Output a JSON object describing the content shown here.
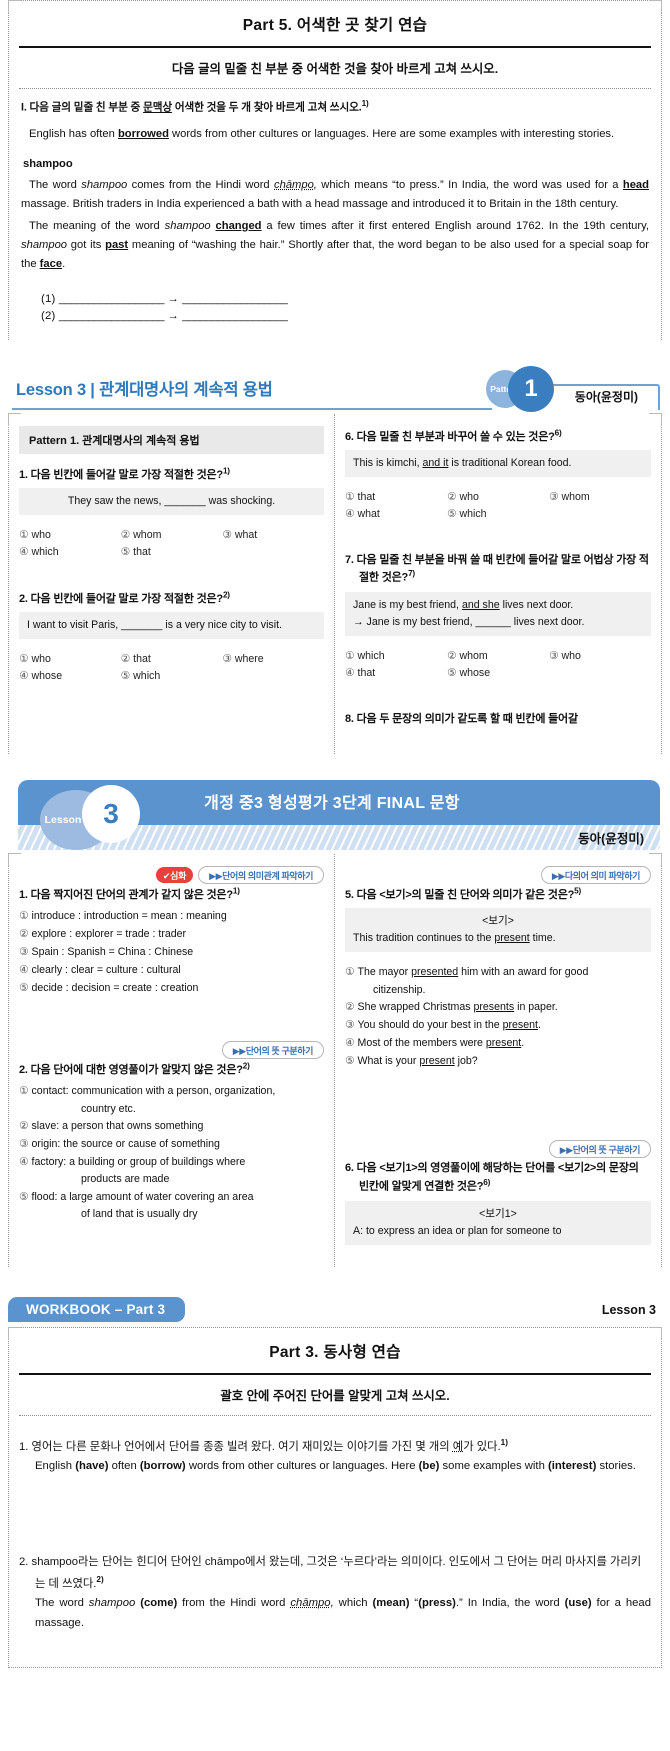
{
  "part5": {
    "title": "Part 5. 어색한 곳 찾기 연습",
    "directive": "다음 글의 밑줄 친 부분 중 어색한 것을 찾아 바르게 고쳐 쓰시오.",
    "question_pre": "I. 다음 글의 밑줄 친 부분 중 ",
    "question_u": "문맥상",
    "question_post": " 어색한 것을 두 개 찾아 바르게 고쳐 쓰시오.",
    "question_sup": "1)",
    "intro_p1_a": "English has often ",
    "intro_p1_b": "borrowed",
    "intro_p1_c": " words from other cultures or languages. Here are some examples with interesting stories.",
    "subhead": "shampoo",
    "p2_a": "The word ",
    "p2_it1": "shampoo",
    "p2_b": " comes from the Hindi word ",
    "p2_it2": "chāmpo,",
    "p2_c": " which means “to press.” In India, the word was used for a ",
    "p2_bu1": "head",
    "p2_d": " massage. British traders in India experienced a bath with a head massage and introduced it to Britain in the 18th century.",
    "p3_a": "The meaning of the word ",
    "p3_it1": "shampoo",
    "p3_b": " ",
    "p3_bu1": "changed",
    "p3_c": " a few times after it first entered English around 1762. In the 19th century, ",
    "p3_it2": "shampoo",
    "p3_d": " got its ",
    "p3_bu2": "past",
    "p3_e": " meaning of “washing the hair.” Shortly after that, the word began to be also used for a special soap for the ",
    "p3_bu3": "face",
    "p3_f": ".",
    "answer_rows": [
      {
        "label": "(1)",
        "blank1": "__________________",
        "arrow": "→",
        "blank2": "__________________"
      },
      {
        "label": "(2)",
        "blank1": "__________________",
        "arrow": "→",
        "blank2": "__________________"
      }
    ]
  },
  "lesson3_pattern": {
    "header_title": "Lesson 3 | 관계대명사의 계속적 용법",
    "pattern_word": "Pattern",
    "pattern_num": "1",
    "author": "동아(윤정미)",
    "pattern_bar": "Pattern 1. 관계대명사의 계속적 용법",
    "left_questions": [
      {
        "num": "1. 다음 빈칸에 들어갈 말로 가장 적절한 것은?",
        "sup": "1)",
        "stem_pre": "They saw the news, ",
        "stem_blank": "_______",
        "stem_post": " was shocking.",
        "stem_center": true,
        "choices": [
          "who",
          "whom",
          "what",
          "which",
          "that"
        ]
      },
      {
        "num": "2. 다음 빈칸에 들어갈 말로 가장 적절한 것은?",
        "sup": "2)",
        "stem_pre": "I want to visit Paris, ",
        "stem_blank": "_______",
        "stem_post": " is a very nice city to visit.",
        "stem_center": false,
        "choices": [
          "who",
          "that",
          "where",
          "whose",
          "which"
        ]
      }
    ],
    "right_questions": [
      {
        "num": "6. 다음 밑줄 친 부분과 바꾸어 쓸 수 있는 것은?",
        "sup": "6)",
        "stem_pre": "This is kimchi, ",
        "stem_u": "and it",
        "stem_post": " is traditional Korean food.",
        "choices": [
          "that",
          "who",
          "whom",
          "what",
          "which"
        ]
      },
      {
        "num": "7. 다음 밑줄 친 부분을 바꿔 쓸 때 빈칸에 들어갈 말로 어법상 가장 적절한 것은?",
        "sup": "7)",
        "stem_line1_pre": "Jane is my best friend, ",
        "stem_line1_u": "and she",
        "stem_line1_post": " lives next door.",
        "stem_line2_pre": "→ Jane is my best friend, ",
        "stem_line2_blank": "______",
        "stem_line2_post": " lives next door.",
        "choices": [
          "which",
          "whom",
          "who",
          "that",
          "whose"
        ]
      }
    ],
    "right_q8": "8. 다음 두 문장의 의미가 같도록 할 때 빈칸에 들어갈"
  },
  "final": {
    "lesson_word": "Lesson",
    "lesson_num": "3",
    "title": "개정 중3 형성평가 3단계 FINAL 문항",
    "author": "동아(윤정미)",
    "left": [
      {
        "badge_red": "✔심화",
        "badge_tag": "▶▶단어의 의미관계 파악하기",
        "num": "1. 다음 짝지어진 단어의 관계가 같지 않은 것은?",
        "sup": "1)",
        "items": [
          "introduce : introduction = mean : meaning",
          "explore : explorer = trade : trader",
          "Spain : Spanish = China : Chinese",
          "clearly : clear = culture : cultural",
          "decide : decision = create : creation"
        ]
      },
      {
        "badge_red": "",
        "badge_tag": "▶▶단어의 뜻 구분하기",
        "num": "2. 다음 단어에 대한 영영풀이가 알맞지 않은 것은?",
        "sup": "2)",
        "items_wrapped": [
          {
            "main": "contact: communication with a person, organization,",
            "cont": "country etc."
          },
          {
            "main": "slave: a person that owns something",
            "cont": ""
          },
          {
            "main": "origin: the source or cause of something",
            "cont": ""
          },
          {
            "main": "factory: a building or group of buildings where",
            "cont": "products are made"
          },
          {
            "main": "flood: a large amount of water covering an area",
            "cont": "of land that is usually dry"
          }
        ]
      }
    ],
    "right": [
      {
        "badge_tag": "▶▶다의어 의미 파악하기",
        "num": "5. 다음 <보기>의 밑줄 친 단어와 의미가 같은 것은?",
        "sup": "5)",
        "box_label": "<보기>",
        "box_pre": "This tradition continues to the ",
        "box_u": "present",
        "box_post": " time.",
        "items_wrapped": [
          {
            "pre": "The mayor ",
            "u": "presented",
            "post": " him with an award for good",
            "cont": "citizenship."
          },
          {
            "pre": "She wrapped Christmas ",
            "u": "presents",
            "post": " in paper.",
            "cont": ""
          },
          {
            "pre": "You should do your best in the ",
            "u": "present",
            "post": ".",
            "cont": ""
          },
          {
            "pre": "Most of the members were ",
            "u": "present",
            "post": ".",
            "cont": ""
          },
          {
            "pre": "What is your ",
            "u": "present",
            "post": " job?",
            "cont": ""
          }
        ]
      },
      {
        "badge_tag": "▶▶단어의 뜻 구분하기",
        "num": "6. 다음 <보기1>의 영영풀이에 해당하는 단어를 <보기2>의 문장의 빈칸에 알맞게 연결한 것은?",
        "sup": "6)",
        "box_label": "<보기1>",
        "box_text": "A: to express an idea or plan for someone to"
      }
    ]
  },
  "workbook": {
    "tab": "WORKBOOK – Part 3",
    "lesson": "Lesson 3",
    "title": "Part 3. 동사형 연습",
    "directive": "괄호 안에 주어진 단어를 알맞게 고쳐 쓰시오.",
    "items": [
      {
        "ko_a": "1. 영어는 다른 문화나 언어에서 단어를 종종 빌려 왔다. 여기 재미있는 이야기를 가진 몇 개의 ",
        "ko_u": "예",
        "ko_b": "가 있다.",
        "sup": "1)",
        "en_parts": [
          {
            "t": "English ",
            "b": false
          },
          {
            "t": "(have)",
            "b": true
          },
          {
            "t": " often ",
            "b": false
          },
          {
            "t": "(borrow)",
            "b": true
          },
          {
            "t": " words from other cultures or languages. Here ",
            "b": false
          },
          {
            "t": "(be)",
            "b": true
          },
          {
            "t": " some examples with ",
            "b": false
          },
          {
            "t": "(interest)",
            "b": true
          },
          {
            "t": " stories.",
            "b": false
          }
        ]
      },
      {
        "ko_a": "2. shampoo라는 단어는 힌디어 단어인 chāmpo에서 왔는데, 그것은 ‘누르다’라는 의미이다. 인도에서 그 단어는 머리 마사지를 가리키는 데 쓰였다.",
        "ko_u": "",
        "ko_b": "",
        "sup": "2)",
        "en_parts": [
          {
            "t": "The word ",
            "b": false
          },
          {
            "t": "shampoo ",
            "b": false,
            "i": true
          },
          {
            "t": "(come)",
            "b": true
          },
          {
            "t": " from the Hindi word ",
            "b": false
          },
          {
            "t": "chāmpo,",
            "b": false,
            "i": true
          },
          {
            "t": " which ",
            "b": false
          },
          {
            "t": "(mean)",
            "b": true
          },
          {
            "t": " “",
            "b": false
          },
          {
            "t": "(press)",
            "b": true
          },
          {
            "t": ".” In India, the word ",
            "b": false
          },
          {
            "t": "(use)",
            "b": true
          },
          {
            "t": " for a head massage.",
            "b": false
          }
        ]
      }
    ]
  },
  "colors": {
    "accent_blue": "#5b93ce",
    "deep_blue": "#3b7ec0",
    "light_blue": "#9dbbe0",
    "title_blue": "#2f79bd",
    "badge_red": "#e8413c",
    "stem_gray": "#f0f0f0"
  }
}
